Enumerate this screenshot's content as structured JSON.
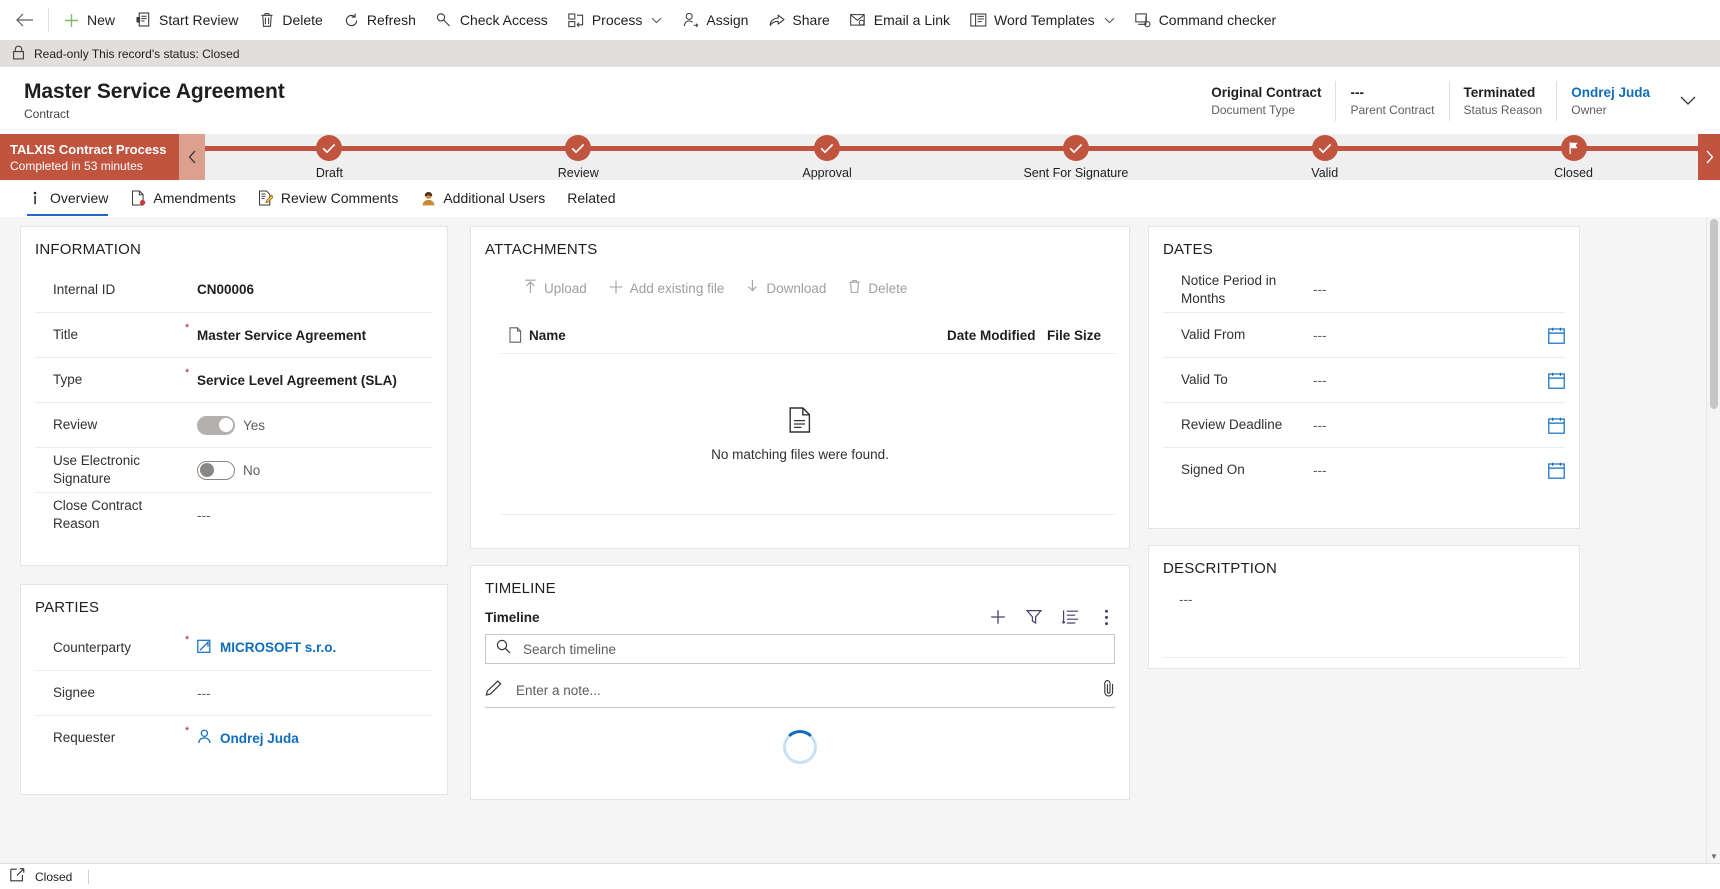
{
  "commandbar": {
    "back_label": "Back",
    "buttons": [
      {
        "label": "New",
        "icon": "plus-icon",
        "chevron": false
      },
      {
        "label": "Start Review",
        "icon": "start-review-icon",
        "chevron": false
      },
      {
        "label": "Delete",
        "icon": "trash-icon",
        "chevron": false
      },
      {
        "label": "Refresh",
        "icon": "refresh-icon",
        "chevron": false
      },
      {
        "label": "Check Access",
        "icon": "key-icon",
        "chevron": false
      },
      {
        "label": "Process",
        "icon": "process-icon",
        "chevron": true
      },
      {
        "label": "Assign",
        "icon": "assign-user-icon",
        "chevron": false
      },
      {
        "label": "Share",
        "icon": "share-icon",
        "chevron": false
      },
      {
        "label": "Email a Link",
        "icon": "email-link-icon",
        "chevron": false
      },
      {
        "label": "Word Templates",
        "icon": "word-template-icon",
        "chevron": true
      },
      {
        "label": "Command checker",
        "icon": "command-checker-icon",
        "chevron": false
      }
    ]
  },
  "notification": {
    "icon": "lock-icon",
    "text": "Read-only This record's status: Closed"
  },
  "record_header": {
    "title": "Master Service Agreement",
    "subtitle": "Contract",
    "fields": [
      {
        "value": "Original Contract",
        "label": "Document Type",
        "is_link": false
      },
      {
        "value": "---",
        "label": "Parent Contract",
        "is_link": false
      },
      {
        "value": "Terminated",
        "label": "Status Reason",
        "is_link": false
      },
      {
        "value": "Ondrej Juda",
        "label": "Owner",
        "is_link": true
      }
    ],
    "expand_icon": "chevron-down-icon"
  },
  "process_flow": {
    "name": "TALXIS Contract Process",
    "status": "Completed in 53 minutes",
    "accent_color": "#c1543f",
    "prev_icon": "chevron-left-icon",
    "next_icon": "chevron-right-icon",
    "stages": [
      {
        "label": "Draft",
        "completed": true
      },
      {
        "label": "Review",
        "completed": true
      },
      {
        "label": "Approval",
        "completed": true
      },
      {
        "label": "Sent For Signature",
        "completed": true
      },
      {
        "label": "Valid",
        "completed": true
      },
      {
        "label": "Closed",
        "completed": true,
        "icon": "flag-icon"
      }
    ]
  },
  "tabs": [
    {
      "label": "Overview",
      "icon": "info-icon",
      "active": true
    },
    {
      "label": "Amendments",
      "icon": "amendments-icon",
      "active": false
    },
    {
      "label": "Review Comments",
      "icon": "review-comments-icon",
      "active": false
    },
    {
      "label": "Additional Users",
      "icon": "additional-users-icon",
      "active": false
    },
    {
      "label": "Related",
      "icon": "",
      "active": false
    }
  ],
  "information": {
    "title": "INFORMATION",
    "rows": [
      {
        "label": "Internal ID",
        "required": false,
        "type": "text",
        "value": "CN00006"
      },
      {
        "label": "Title",
        "required": true,
        "type": "text",
        "value": "Master Service Agreement"
      },
      {
        "label": "Type",
        "required": true,
        "type": "text",
        "value": "Service Level Agreement (SLA)"
      },
      {
        "label": "Review",
        "required": false,
        "type": "toggle",
        "toggle_state": "on",
        "value": "Yes"
      },
      {
        "label": "Use Electronic Signature",
        "required": false,
        "type": "toggle",
        "toggle_state": "off",
        "value": "No"
      },
      {
        "label": "Close Contract Reason",
        "required": false,
        "type": "empty",
        "value": "---"
      }
    ]
  },
  "parties": {
    "title": "PARTIES",
    "rows": [
      {
        "label": "Counterparty",
        "required": true,
        "type": "lookup",
        "icon": "account-icon",
        "value": "MICROSOFT s.r.o."
      },
      {
        "label": "Signee",
        "required": false,
        "type": "empty",
        "value": "---"
      },
      {
        "label": "Requester",
        "required": true,
        "type": "lookup",
        "icon": "contact-icon",
        "value": "Ondrej Juda"
      }
    ]
  },
  "attachments": {
    "title": "ATTACHMENTS",
    "toolbar": [
      {
        "label": "Upload",
        "icon": "upload-icon"
      },
      {
        "label": "Add existing file",
        "icon": "plus-icon"
      },
      {
        "label": "Download",
        "icon": "download-icon"
      },
      {
        "label": "Delete",
        "icon": "trash-icon"
      }
    ],
    "columns": {
      "name": "Name",
      "date_modified": "Date Modified",
      "file_size": "File Size"
    },
    "empty_message": "No matching files were found.",
    "empty_icon": "document-icon"
  },
  "timeline": {
    "title": "TIMELINE",
    "subtitle": "Timeline",
    "actions": [
      {
        "icon": "plus-icon",
        "name": "create-timeline-record"
      },
      {
        "icon": "filter-icon",
        "name": "filter-timeline"
      },
      {
        "icon": "sort-icon",
        "name": "sort-timeline"
      },
      {
        "icon": "more-icon",
        "name": "more-timeline-commands"
      }
    ],
    "search_placeholder": "Search timeline",
    "search_value": "",
    "note_placeholder": "Enter a note...",
    "note_value": "",
    "attach_icon": "paperclip-icon"
  },
  "dates": {
    "title": "DATES",
    "rows": [
      {
        "label": "Notice Period in Months",
        "value": "---",
        "calendar": false
      },
      {
        "label": "Valid From",
        "value": "---",
        "calendar": true
      },
      {
        "label": "Valid To",
        "value": "---",
        "calendar": true
      },
      {
        "label": "Review Deadline",
        "value": "---",
        "calendar": true
      },
      {
        "label": "Signed On",
        "value": "---",
        "calendar": true
      }
    ]
  },
  "description": {
    "title": "DESCRITPTION",
    "value": "---"
  },
  "statusbar": {
    "icon": "popout-icon",
    "text": "Closed"
  }
}
